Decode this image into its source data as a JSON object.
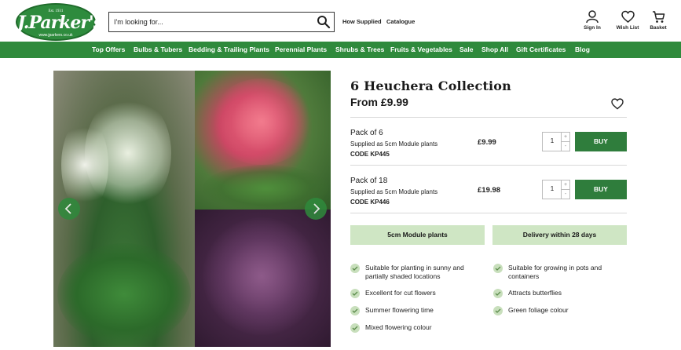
{
  "brand": {
    "logo_est": "Est. 1931",
    "logo_name": "J.Parker's",
    "logo_url": "www.jparkers.co.uk"
  },
  "search": {
    "placeholder": "I'm looking for..."
  },
  "top_links": [
    "How Supplied",
    "Catalogue"
  ],
  "header_icons": [
    {
      "label": "Sign In",
      "icon": "user-icon"
    },
    {
      "label": "Wish List",
      "icon": "heart-icon"
    },
    {
      "label": "Basket",
      "icon": "basket-icon"
    }
  ],
  "nav": [
    "Top Offers",
    "Bulbs & Tubers",
    "Bedding & Trailing Plants",
    "Perennial Plants",
    "Shrubs & Trees",
    "Fruits & Vegetables",
    "Sale",
    "Shop All",
    "Gift Certificates",
    "Blog"
  ],
  "product": {
    "title": "6 Heuchera Collection",
    "from_price": "From £9.99",
    "packs": [
      {
        "name": "Pack of 6",
        "supplied": "Supplied as 5cm Module plants",
        "code": "CODE KP445",
        "price": "£9.99",
        "qty": "1",
        "buy": "BUY"
      },
      {
        "name": "Pack of 18",
        "supplied": "Supplied as 5cm Module plants",
        "code": "CODE KP446",
        "price": "£19.98",
        "qty": "1",
        "buy": "BUY"
      }
    ],
    "tags": [
      "5cm Module plants",
      "Delivery within 28 days"
    ],
    "features_left": [
      "Suitable for planting in sunny and",
      "partially shaded locations",
      "Excellent for cut flowers",
      "Summer flowering time",
      "Mixed flowering colour"
    ],
    "features_right": [
      "Suitable for growing in pots and",
      "containers",
      "Attracts butterflies",
      "Green foliage colour"
    ]
  },
  "colors": {
    "brand_green": "#2f8a3c",
    "button_green": "#2f7d3c",
    "tag_bg": "#cfe6c4"
  }
}
